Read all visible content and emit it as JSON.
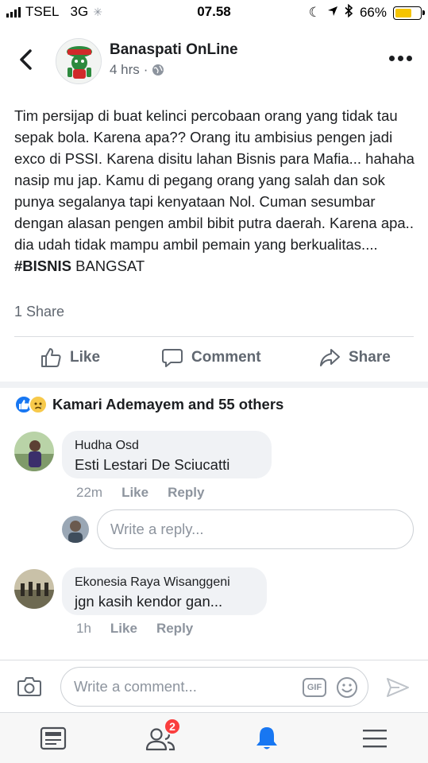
{
  "status": {
    "carrier": "TSEL",
    "network": "3G",
    "time": "07.58",
    "battery_pct": "66%",
    "battery_level": 0.66
  },
  "post": {
    "page_name": "Banaspati OnLine",
    "time_ago": "4 hrs",
    "separator": "·",
    "body": "Tim persijap di buat kelinci percobaan orang yang tidak tau sepak bola. Karena apa?? Orang itu ambisius pengen jadi exco di PSSI. Karena disitu lahan Bisnis para Mafia... hahaha nasip mu jap. Kamu di pegang orang yang salah dan sok punya segalanya tapi kenyataan Nol. Cuman sesumbar dengan alasan pengen ambil bibit putra daerah. Karena apa.. dia udah tidak mampu ambil pemain yang berkualitas....",
    "hashtag": "#BISNIS",
    "body_end": " BANGSAT",
    "shares": "1 Share"
  },
  "actions": {
    "like": "Like",
    "comment": "Comment",
    "share": "Share"
  },
  "reactions": {
    "summary": "Kamari Ademayem and 55 others"
  },
  "comments": [
    {
      "author": "Hudha Osd",
      "text": "Esti Lestari De Sciucatti",
      "time": "22m",
      "like": "Like",
      "reply": "Reply"
    },
    {
      "author": "Ekonesia Raya Wisanggeni",
      "text": "jgn kasih kendor gan...",
      "time": "1h",
      "like": "Like",
      "reply": "Reply"
    }
  ],
  "reply_input": {
    "placeholder": "Write a reply..."
  },
  "composer": {
    "placeholder": "Write a comment...",
    "gif_label": "GIF"
  },
  "tabbar": {
    "friends_badge": "2"
  },
  "colors": {
    "brand_blue": "#1877f2",
    "text_secondary": "#606770",
    "badge_red": "#fa3e3e",
    "battery_yellow": "#f5c400"
  }
}
